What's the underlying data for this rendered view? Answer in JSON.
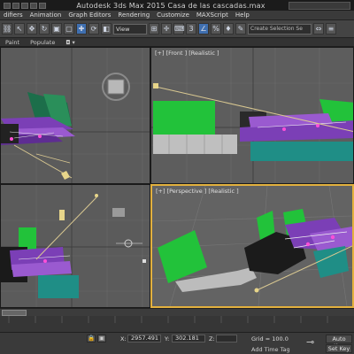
{
  "window": {
    "title": "Autodesk 3ds Max  2015     Casa de las cascadas.max"
  },
  "menu": {
    "items": [
      "difiers",
      "Animation",
      "Graph Editors",
      "Rendering",
      "Customize",
      "MAXScript",
      "Help"
    ]
  },
  "toolbar": {
    "view_dropdown": "View",
    "selection_set_placeholder": "Create Selection Se"
  },
  "ribbon": {
    "tabs": [
      "Paint",
      "Populate"
    ]
  },
  "viewports": {
    "top_left": {
      "label": ""
    },
    "front": {
      "label": "[+] [Front ] [Realistic ]"
    },
    "left": {
      "label": ""
    },
    "perspective": {
      "label": "[+] [Perspective ] [Realistic ]"
    }
  },
  "status": {
    "x_label": "X:",
    "x_value": "2957.491",
    "y_label": "Y:",
    "y_value": "302.181",
    "z_label": "Z:",
    "z_value": "",
    "grid": "Grid = 100.0",
    "add_time_tag": "Add Time Tag",
    "auto_key": "Auto Key",
    "set_key": "Set Key"
  },
  "colors": {
    "active_viewport_border": "#e3b13e",
    "building_purple": "#7b3fb6",
    "terrace_green": "#26c23c",
    "water_teal": "#1f8e86",
    "wall_gray": "#b9b9b9"
  }
}
